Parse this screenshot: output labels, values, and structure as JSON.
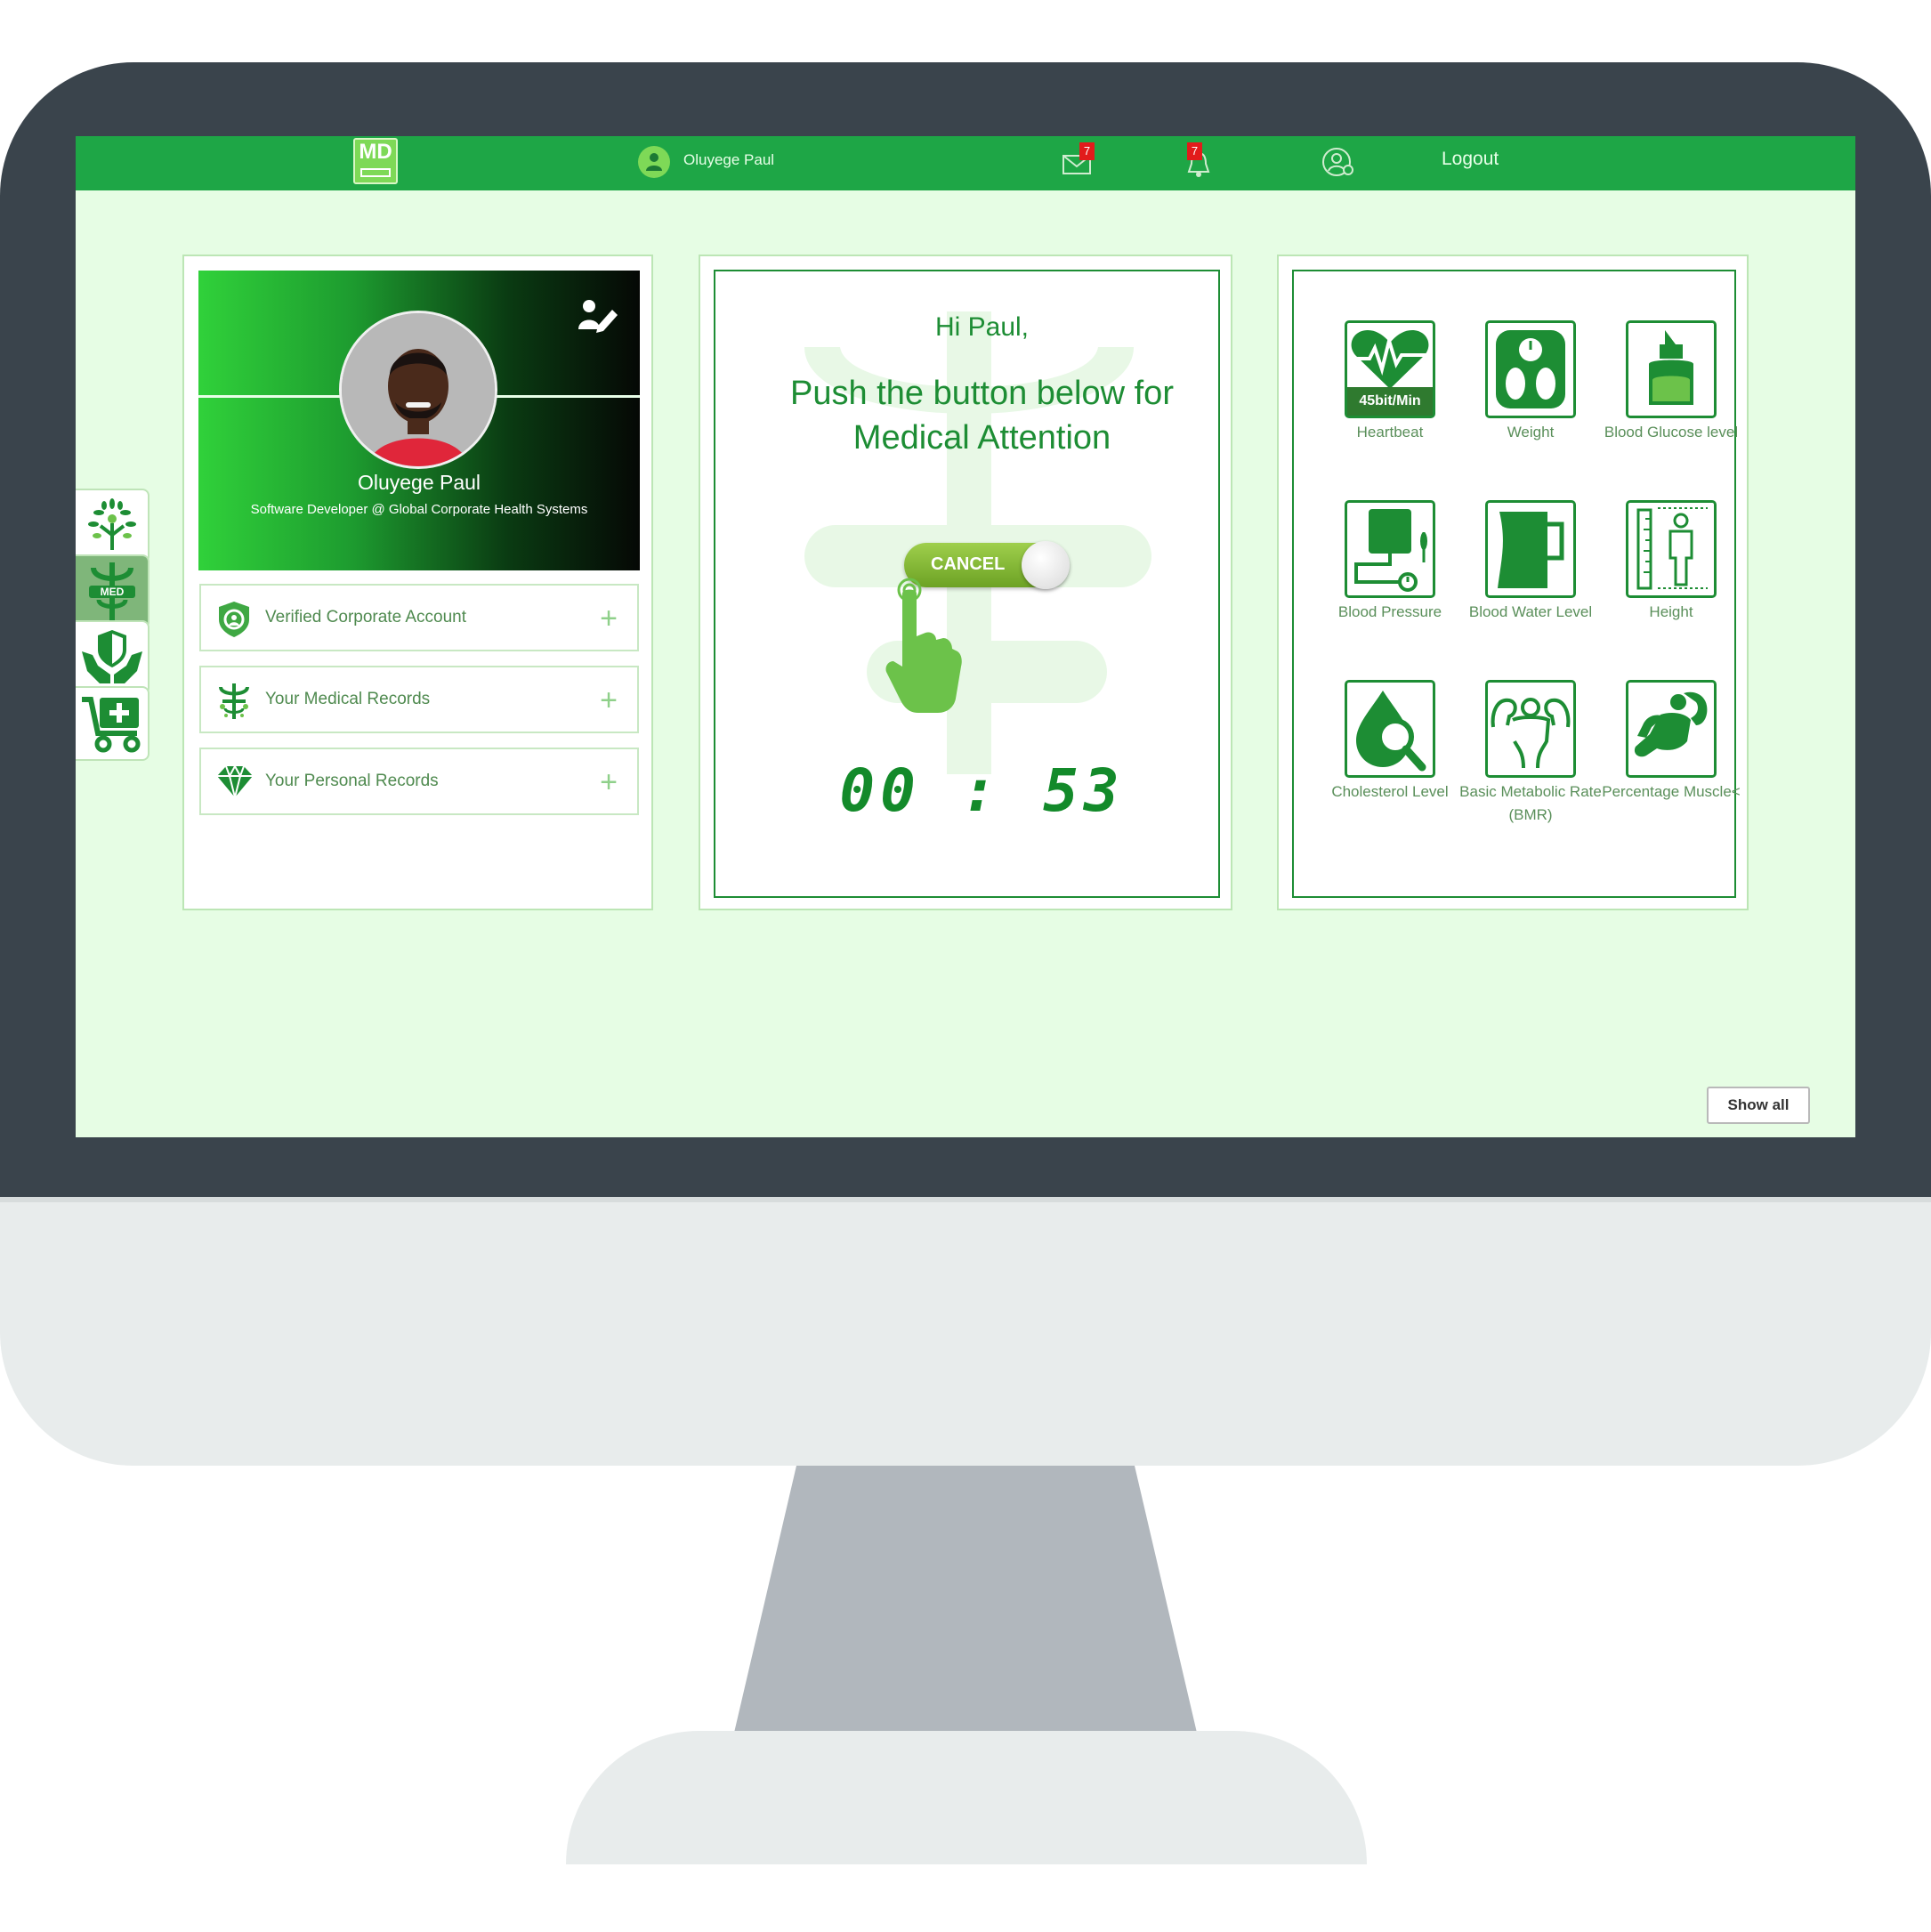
{
  "topbar": {
    "logo_text": "MD",
    "user_name": "Oluyege Paul",
    "messages_count": "7",
    "notifications_count": "7",
    "logout_label": "Logout"
  },
  "profile": {
    "name": "Oluyege Paul",
    "title": "Software Developer @ Global Corporate Health Systems"
  },
  "accordion": [
    {
      "label": "Verified Corporate Account"
    },
    {
      "label": "Your Medical Records"
    },
    {
      "label": "Your Personal Records"
    }
  ],
  "emergency": {
    "greeting": "Hi Paul,",
    "prompt_line1": "Push the button below for",
    "prompt_line2": "Medical Attention",
    "cancel_label": "CANCEL",
    "timer": "00 : 53"
  },
  "metrics": [
    {
      "label": "Heartbeat",
      "value": "45bit/Min",
      "icon": "heartbeat-icon"
    },
    {
      "label": "Weight",
      "icon": "weighing-scale-icon"
    },
    {
      "label": "Blood Glucose level",
      "icon": "glucose-bottle-icon"
    },
    {
      "label": "Blood Pressure",
      "icon": "blood-pressure-icon"
    },
    {
      "label": "Blood Water Level",
      "icon": "water-jug-icon"
    },
    {
      "label": "Height",
      "icon": "height-measure-icon"
    },
    {
      "label": "Cholesterol Level",
      "icon": "cholesterol-icon"
    },
    {
      "label": "Basic Metabolic Rate (BMR)",
      "icon": "metabolic-body-icon"
    },
    {
      "label": "Percentage Muscle<",
      "icon": "muscle-icon"
    }
  ],
  "sidebar": [
    {
      "icon": "wellness-tree-icon"
    },
    {
      "icon": "med-caduceus-icon",
      "text": "MED"
    },
    {
      "icon": "protected-hands-icon"
    },
    {
      "icon": "medical-cart-icon"
    }
  ],
  "show_all_label": "Show all",
  "colors": {
    "primary": "#1ea646",
    "accent": "#7ed957",
    "screen_bg": "#e6fde4",
    "badge": "#e21b1b"
  }
}
